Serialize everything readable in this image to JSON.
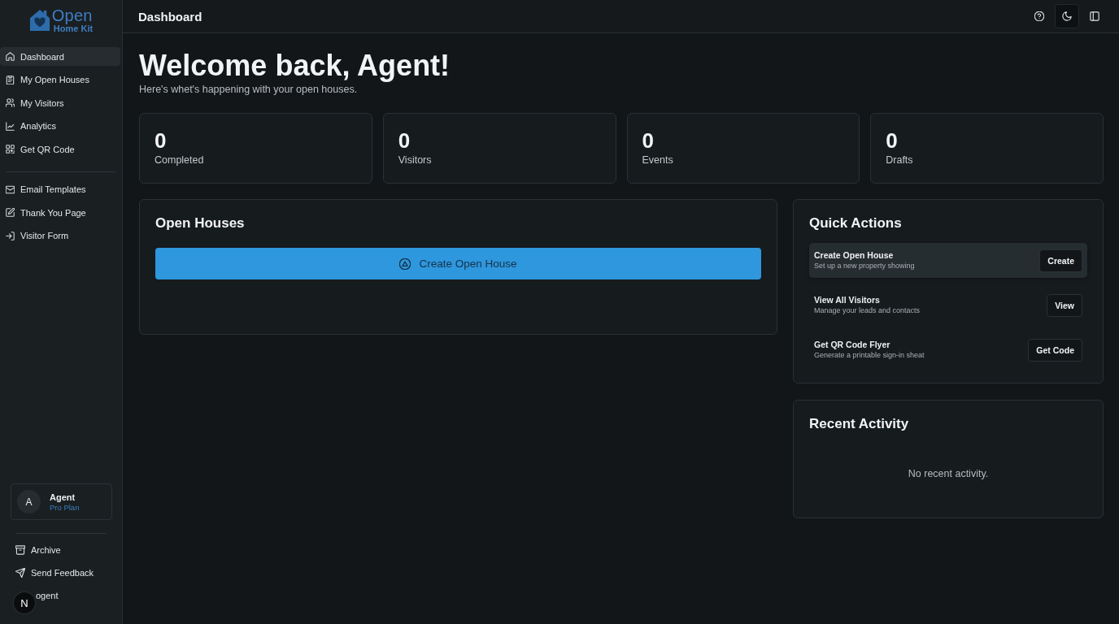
{
  "sidebar": {
    "logo": {
      "line_1": "Open",
      "line_2": "Home Kit"
    },
    "primary_nav": [
      {
        "label": "Dashboard",
        "selected": true
      },
      {
        "label": "My Open Houses",
        "selected": false
      },
      {
        "label": "My Visitors",
        "selected": false
      },
      {
        "label": "Analytics",
        "selected": false
      },
      {
        "label": "Get QR Code",
        "selected": false
      }
    ],
    "secondary_nav": [
      {
        "label": "Email Templates",
        "selected": false
      },
      {
        "label": "Thank You Page",
        "selected": false
      },
      {
        "label": "Visitor Form",
        "selected": false
      }
    ],
    "user": {
      "avatar_initial": "A",
      "name": "Agent",
      "plan": "Pro Plan"
    },
    "footer_links": [
      "Archive",
      "Send Feedback",
      "ogent"
    ],
    "dev_badge": "N"
  },
  "top_bar": {
    "title": "Dashboard",
    "buttons": [
      {
        "highlighted": false
      },
      {
        "highlighted": true
      },
      {
        "highlighted": false
      }
    ]
  },
  "heading": "Welcome back, Agent!",
  "subtitle": "Here's whet's happening with your open houses.",
  "stats": [
    {
      "value": "0",
      "label": "Completed"
    },
    {
      "value": "0",
      "label": "Visitors"
    },
    {
      "value": "0",
      "label": "Events"
    },
    {
      "value": "0",
      "label": "Drafts"
    }
  ],
  "open_houses": {
    "title": "Open Houses",
    "create_button": "Create Open House"
  },
  "quick_actions": {
    "title": "Quick Actions",
    "items": [
      {
        "title": "Create Open House",
        "description": "Set up a new property showing",
        "button": "Create",
        "highlighted": true
      },
      {
        "title": "View All Visitors",
        "description": "Manage your leads and contacts",
        "button": "View",
        "highlighted": false
      },
      {
        "title": "Get QR Code Flyer",
        "description": "Generate a printable sign-in sheat",
        "button": "Get Code",
        "highlighted": false
      }
    ]
  },
  "recent_activity": {
    "title": "Recent Activity",
    "empty_message": "No recent activity."
  }
}
